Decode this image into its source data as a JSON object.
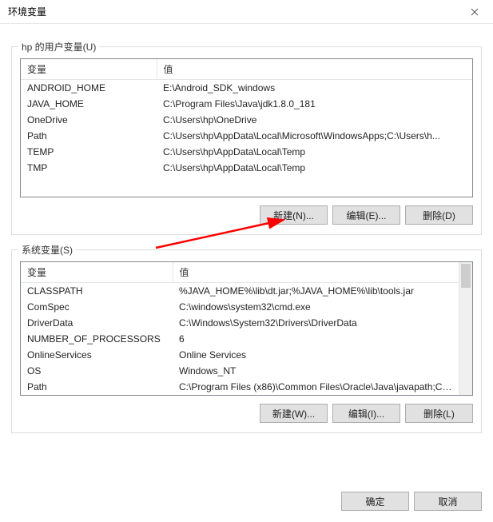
{
  "window": {
    "title": "环境变量"
  },
  "user_vars": {
    "group_label": "hp 的用户变量(U)",
    "header_name": "变量",
    "header_value": "值",
    "rows": [
      {
        "name": "ANDROID_HOME",
        "value": "E:\\Android_SDK_windows"
      },
      {
        "name": "JAVA_HOME",
        "value": "C:\\Program Files\\Java\\jdk1.8.0_181"
      },
      {
        "name": "OneDrive",
        "value": "C:\\Users\\hp\\OneDrive"
      },
      {
        "name": "Path",
        "value": "C:\\Users\\hp\\AppData\\Local\\Microsoft\\WindowsApps;C:\\Users\\h..."
      },
      {
        "name": "TEMP",
        "value": "C:\\Users\\hp\\AppData\\Local\\Temp"
      },
      {
        "name": "TMP",
        "value": "C:\\Users\\hp\\AppData\\Local\\Temp"
      }
    ],
    "buttons": {
      "new": "新建(N)...",
      "edit": "编辑(E)...",
      "delete": "删除(D)"
    }
  },
  "system_vars": {
    "group_label": "系统变量(S)",
    "header_name": "变量",
    "header_value": "值",
    "rows": [
      {
        "name": "CLASSPATH",
        "value": "%JAVA_HOME%\\lib\\dt.jar;%JAVA_HOME%\\lib\\tools.jar"
      },
      {
        "name": "ComSpec",
        "value": "C:\\windows\\system32\\cmd.exe"
      },
      {
        "name": "DriverData",
        "value": "C:\\Windows\\System32\\Drivers\\DriverData"
      },
      {
        "name": "NUMBER_OF_PROCESSORS",
        "value": "6"
      },
      {
        "name": "OnlineServices",
        "value": "Online Services"
      },
      {
        "name": "OS",
        "value": "Windows_NT"
      },
      {
        "name": "Path",
        "value": "C:\\Program Files (x86)\\Common Files\\Oracle\\Java\\javapath;C:..."
      }
    ],
    "buttons": {
      "new": "新建(W)...",
      "edit": "编辑(I)...",
      "delete": "删除(L)"
    }
  },
  "footer": {
    "ok": "确定",
    "cancel": "取消"
  }
}
